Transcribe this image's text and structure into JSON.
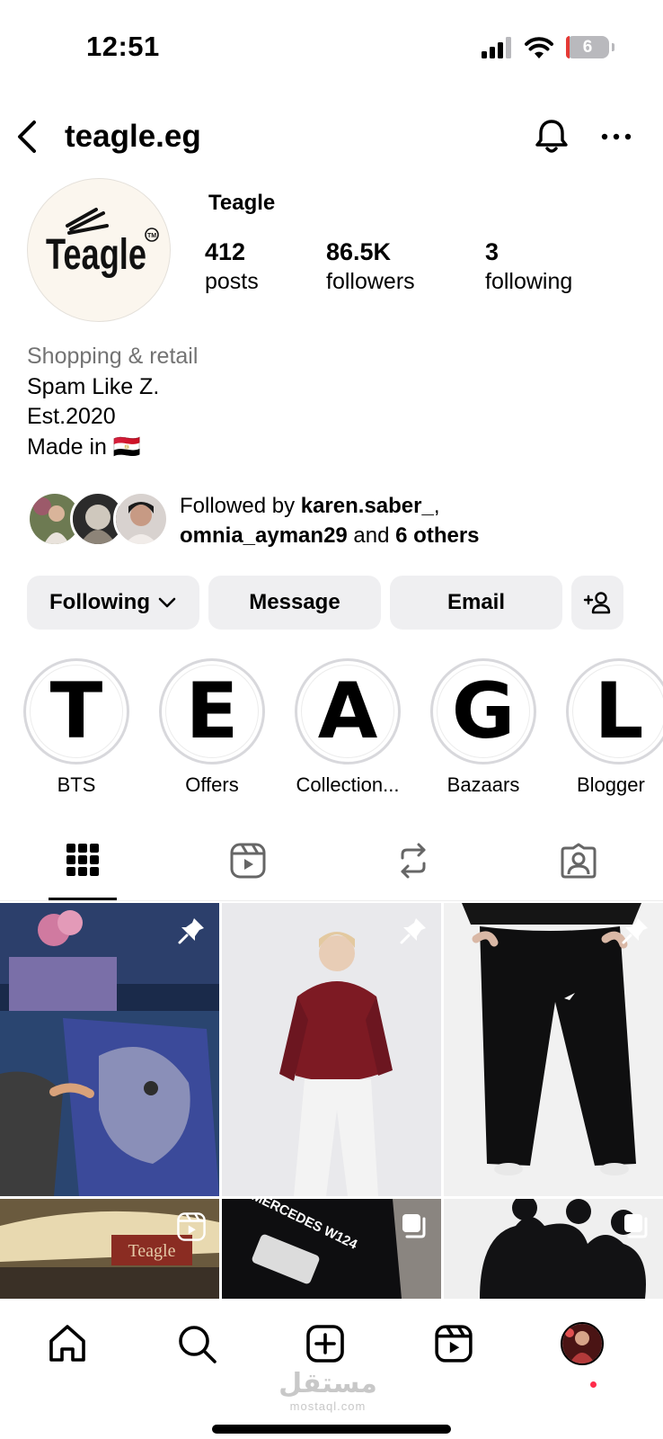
{
  "status_bar": {
    "time": "12:51",
    "battery": "6"
  },
  "header": {
    "username": "teagle.eg"
  },
  "profile": {
    "logo_text": "Teagle",
    "display_name": "Teagle",
    "stats": [
      {
        "value": "412",
        "label": "posts"
      },
      {
        "value": "86.5K",
        "label": "followers"
      },
      {
        "value": "3",
        "label": "following"
      }
    ],
    "bio": {
      "category": "Shopping & retail",
      "lines": [
        "Spam Like Z.",
        "Est.2020",
        "Made in 🇪🇬"
      ]
    },
    "followed_by": {
      "prefix": "Followed by ",
      "user1": "karen.saber_",
      "separator": ",",
      "user2": "omnia_ayman29",
      "middle": " and ",
      "others": "6 others"
    }
  },
  "actions": {
    "following": "Following",
    "message": "Message",
    "email": "Email"
  },
  "highlights": [
    {
      "letter": "T",
      "label": "BTS"
    },
    {
      "letter": "E",
      "label": "Offers"
    },
    {
      "letter": "A",
      "label": "Collection..."
    },
    {
      "letter": "G",
      "label": "Bazaars"
    },
    {
      "letter": "L",
      "label": "Blogger"
    }
  ],
  "tabs": [
    "grid-icon",
    "reels-icon",
    "reposts-icon",
    "tagged-icon"
  ],
  "grid": {
    "posts": [
      {
        "type": "pinned",
        "overlay": "pin-icon"
      },
      {
        "type": "pinned",
        "overlay": "pin-icon"
      },
      {
        "type": "pinned",
        "overlay": "pin-icon"
      },
      {
        "type": "reel",
        "overlay": "reel-icon",
        "sign_text": "Teagle"
      },
      {
        "type": "carousel",
        "overlay": "carousel-icon",
        "print_text": "MERCEDES W124"
      },
      {
        "type": "carousel",
        "overlay": "carousel-icon"
      }
    ]
  },
  "bottom_nav": [
    "home-icon",
    "search-icon",
    "create-icon",
    "reels-icon",
    "profile-avatar"
  ],
  "watermark": {
    "arabic": "مستقل",
    "latin": "mostaql.com"
  }
}
